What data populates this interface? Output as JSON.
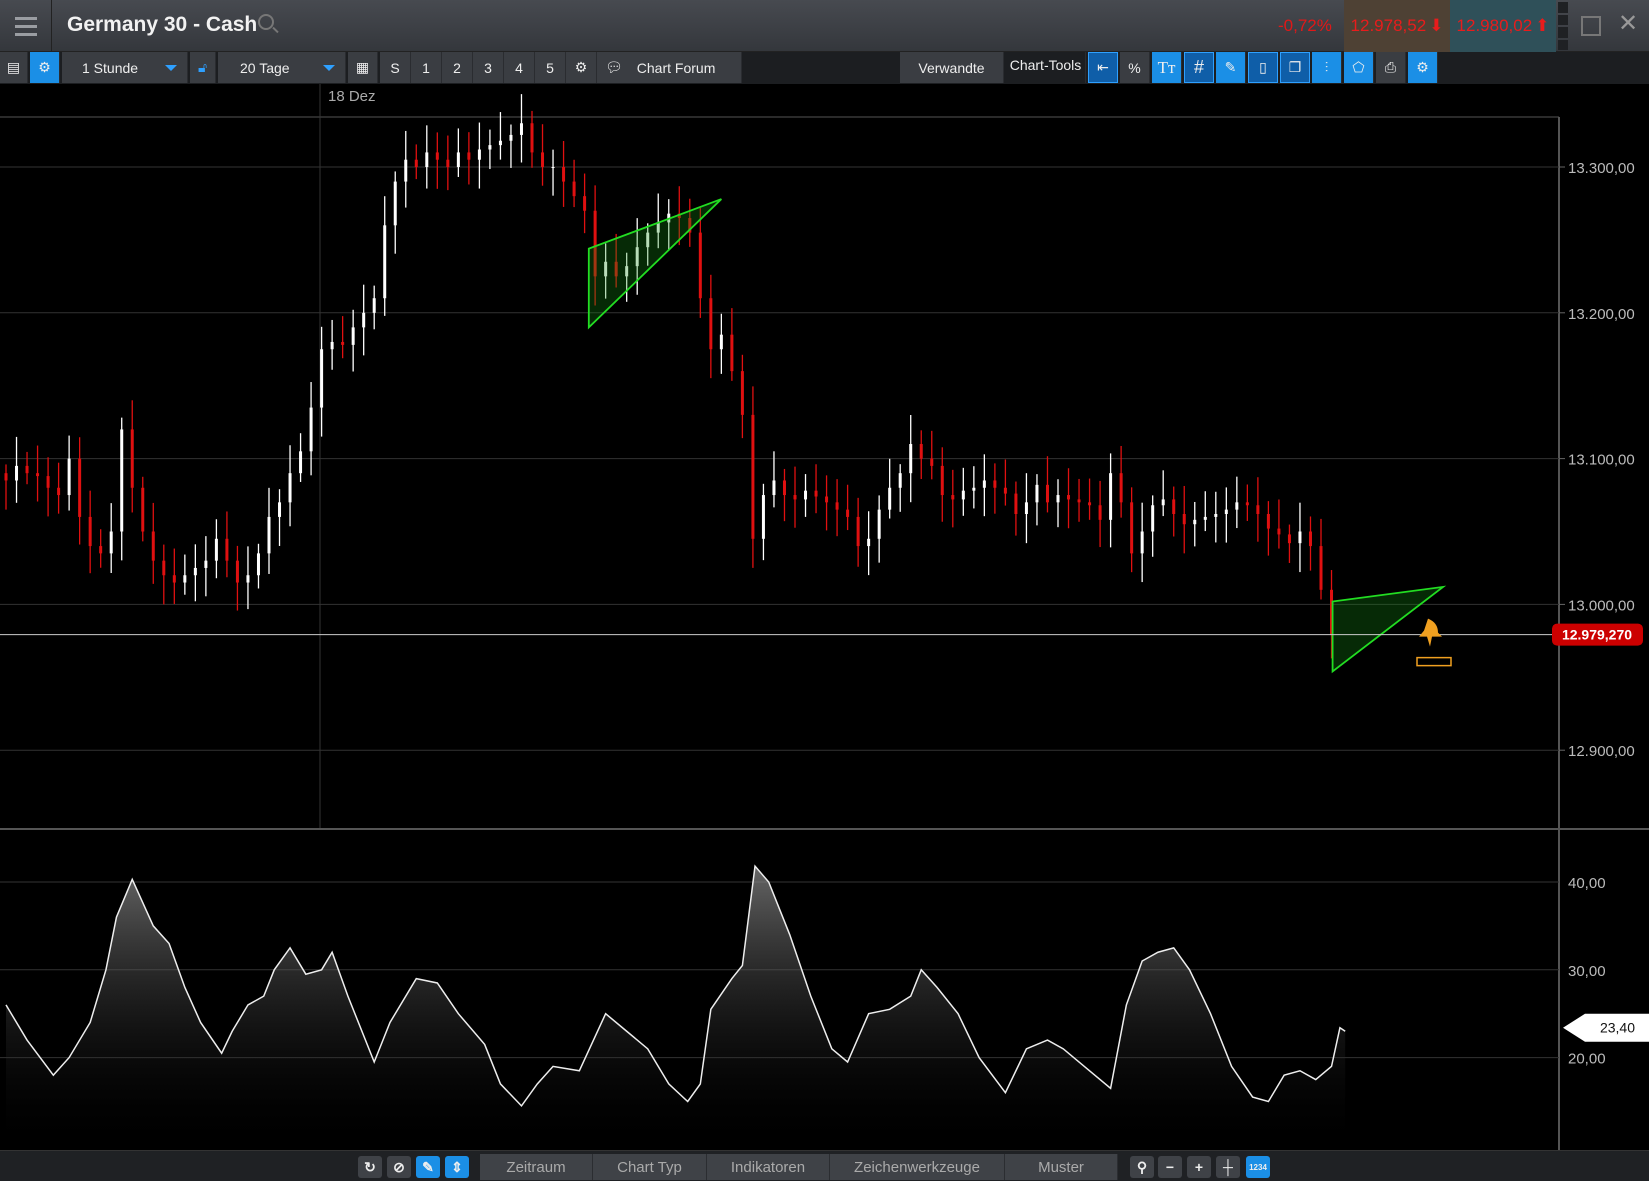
{
  "header": {
    "title": "Germany 30 - Cash",
    "change": "-0,72%",
    "bid": "12.978,52",
    "ask": "12.980,02"
  },
  "toolbar": {
    "interval": "1 Stunde",
    "range": "20 Tage",
    "buttons": [
      "S",
      "1",
      "2",
      "3",
      "4",
      "5"
    ],
    "forum": "Chart Forum",
    "related": "Verwandte",
    "chart_tools": "Chart-Tools",
    "percent": "%",
    "text_tool": "Tт"
  },
  "bottom": {
    "tabs": [
      "Zeitraum",
      "Chart Typ",
      "Indikatoren",
      "Zeichenwerkzeuge",
      "Muster"
    ],
    "numbers_icon": "1234"
  },
  "colors": {
    "up": "#ffffff",
    "down": "#e01010",
    "drawing": "#22dd22",
    "accent": "#1b8fe6",
    "alert": "#f0a020"
  },
  "chart_data": [
    {
      "type": "candlestick",
      "title": "Germany 30 - Cash",
      "date_label": "18 Dez",
      "ylim": [
        12845,
        13340
      ],
      "yticks": [
        "13.300,00",
        "13.200,00",
        "13.100,00",
        "13.000,00",
        "12.900,00"
      ],
      "ytick_values": [
        13300,
        13200,
        13100,
        13000,
        12900
      ],
      "current_price": 12979.27,
      "current_label": "12.979,270",
      "closes": [
        13085,
        13095,
        13090,
        13088,
        13080,
        13075,
        13100,
        13060,
        13040,
        13035,
        13050,
        13120,
        13080,
        13050,
        13030,
        13020,
        13015,
        13020,
        13025,
        13030,
        13045,
        13030,
        13015,
        13020,
        13035,
        13060,
        13070,
        13090,
        13105,
        13135,
        13175,
        13180,
        13178,
        13190,
        13200,
        13210,
        13260,
        13290,
        13305,
        13300,
        13310,
        13305,
        13300,
        13310,
        13305,
        13312,
        13315,
        13318,
        13322,
        13330,
        13310,
        13300,
        13300,
        13290,
        13280,
        13270,
        13225,
        13235,
        13225,
        13232,
        13245,
        13255,
        13262,
        13268,
        13265,
        13255,
        13210,
        13175,
        13185,
        13160,
        13130,
        13045,
        13075,
        13085,
        13075,
        13072,
        13078,
        13074,
        13070,
        13065,
        13060,
        13040,
        13045,
        13065,
        13080,
        13090,
        13110,
        13100,
        13095,
        13075,
        13072,
        13078,
        13080,
        13085,
        13080,
        13076,
        13062,
        13070,
        13082,
        13070,
        13075,
        13072,
        13070,
        13068,
        13058,
        13090,
        13070,
        13035,
        13050,
        13068,
        13072,
        13062,
        13055,
        13058,
        13060,
        13062,
        13065,
        13070,
        13068,
        13062,
        13052,
        13048,
        13042,
        13050,
        13040,
        13010,
        12979
      ],
      "drawings": [
        {
          "type": "triangle",
          "points": [
            [
              55.4,
              13244
            ],
            [
              55.4,
              13190
            ],
            [
              68,
              13278
            ]
          ]
        },
        {
          "type": "triangle",
          "points": [
            [
              126.1,
              13002
            ],
            [
              126.1,
              12954
            ],
            [
              136.6,
              13012
            ]
          ]
        }
      ]
    },
    {
      "type": "area",
      "name": "oscillator",
      "ylim": [
        10,
        45
      ],
      "yticks": [
        "40,00",
        "30,00",
        "20,00"
      ],
      "ytick_values": [
        40,
        30,
        20
      ],
      "current_label": "23,40",
      "current_value": 23.4,
      "x": [
        0,
        2,
        4.5,
        6,
        8,
        9.5,
        10.5,
        12,
        14,
        15.5,
        17,
        18.5,
        20.5,
        21.5,
        23,
        24.5,
        25.5,
        27,
        28.5,
        30,
        31,
        32.5,
        35,
        36.5,
        39,
        41,
        43,
        45.5,
        47,
        49,
        50.5,
        52,
        54.5,
        57,
        59,
        61,
        63,
        64.8,
        66,
        67,
        69,
        70,
        71.2,
        72.5,
        74.5,
        76.5,
        78.5,
        80,
        82,
        84,
        86,
        87,
        88.5,
        90.5,
        92.5,
        95,
        97,
        99,
        100.5,
        103,
        105,
        106.5,
        108,
        109.5,
        111,
        112.5,
        114.5,
        116.5,
        118.5,
        120,
        121.5,
        123,
        124.5,
        126,
        126.8,
        127.3
      ],
      "values": [
        26,
        22,
        18,
        20,
        24,
        30,
        36,
        40.3,
        35,
        33,
        28,
        24,
        20.5,
        23,
        26,
        27,
        30,
        32.5,
        29.5,
        30,
        32,
        27,
        19.5,
        24,
        29,
        28.5,
        25,
        21.5,
        17,
        14.5,
        17,
        19,
        18.5,
        25,
        23,
        21,
        17,
        15,
        17,
        25.5,
        29,
        30.5,
        41.8,
        40,
        34,
        27,
        21,
        19.5,
        25,
        25.5,
        27,
        30,
        28,
        25,
        20,
        16,
        21,
        22,
        21,
        18.5,
        16.5,
        26,
        31,
        32,
        32.5,
        30,
        25,
        19,
        15.5,
        15,
        18,
        18.5,
        17.5,
        19,
        23.4,
        23
      ]
    }
  ]
}
